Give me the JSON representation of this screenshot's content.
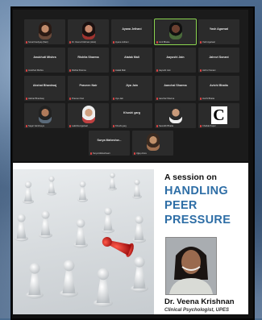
{
  "zoom": {
    "tiles": [
      {
        "id": "t1",
        "name": "",
        "label": "Sonal Kashyap (Nair)",
        "face": "f1"
      },
      {
        "id": "t2",
        "name": "",
        "label": "Dr. Veena Krishnan (Host)",
        "face": "f2"
      },
      {
        "id": "t3",
        "name": "Ayana Jethani",
        "label": "Ayana Jethani",
        "face": ""
      },
      {
        "id": "t4",
        "name": "",
        "label": "Amit Bhatia",
        "face": "f3",
        "active": true
      },
      {
        "id": "t5",
        "name": "Yash Agarwal",
        "label": "Yash Agarwal",
        "face": ""
      },
      {
        "id": "t6",
        "name": "Anubhuti Mishra",
        "label": "Anubhuti Mishra",
        "face": ""
      },
      {
        "id": "t7",
        "name": "Rishita Sharma",
        "label": "Rishita Sharma",
        "face": ""
      },
      {
        "id": "t8",
        "name": "Atalak Mali",
        "label": "Atalak Mali",
        "face": ""
      },
      {
        "id": "t9",
        "name": "Aayushi Jain",
        "label": "Aayushi Jain",
        "face": ""
      },
      {
        "id": "t10",
        "name": "Jahnvi Sonani",
        "label": "Jahnvi Sonani",
        "face": ""
      },
      {
        "id": "t11",
        "name": "Akshat Bhardwaj",
        "label": "Akshat Bhardwaj",
        "face": ""
      },
      {
        "id": "t12",
        "name": "Praveen Nair",
        "label": "Praveen Nair",
        "face": ""
      },
      {
        "id": "t13",
        "name": "Jiya Jain",
        "label": "Jiya Jain",
        "face": ""
      },
      {
        "id": "t14",
        "name": "Aanchal Sharma",
        "label": "Aanchal Sharma",
        "face": ""
      },
      {
        "id": "t15",
        "name": "Avichi Bhatia",
        "label": "Avichi Bhatia",
        "face": ""
      },
      {
        "id": "t16",
        "name": "",
        "label": "Sagar Varshneya",
        "face": "f4"
      },
      {
        "id": "t17",
        "name": "",
        "label": "Lakshita Agarwal",
        "face": "f5"
      },
      {
        "id": "t18",
        "name": "Khushi garg",
        "label": "Khushi garg",
        "face": ""
      },
      {
        "id": "t19",
        "name": "",
        "label": "Saurabh Bhatia",
        "face": "f7"
      },
      {
        "id": "t20",
        "name": "",
        "label": "Chahak Kapur",
        "face": "",
        "logo": "C"
      },
      {
        "id": "t21",
        "name": "Surya Maheshw...",
        "label": "Surya Maheshwari",
        "face": ""
      },
      {
        "id": "t22",
        "name": "",
        "label": "Ujjay Arora",
        "face": "f6"
      }
    ]
  },
  "poster": {
    "intro": "A session on",
    "title_line1": "HANDLING",
    "title_line2": "PEER",
    "title_line3": "PRESSURE",
    "speaker": "Dr. Veena Krishnan",
    "speaker_title": "Clinical Psychologist, UPES",
    "accent": "#2e6ea6"
  }
}
